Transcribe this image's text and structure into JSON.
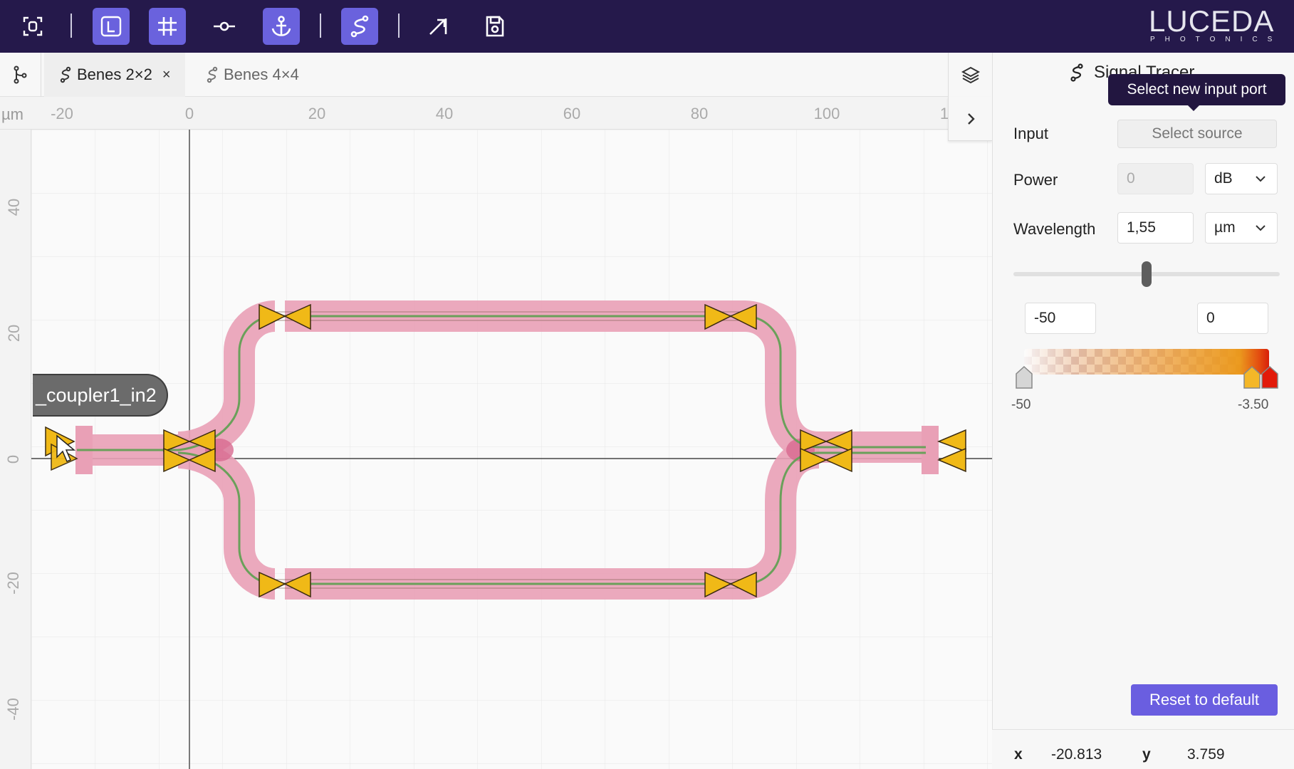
{
  "toolbar": {
    "buttons": [
      {
        "name": "fit-view",
        "icon": "fit-view-icon",
        "active": false
      },
      {
        "name": "layout-view",
        "icon": "layout-view-icon",
        "active": true
      },
      {
        "name": "grid-toggle",
        "icon": "grid-icon",
        "active": true
      },
      {
        "name": "port-tool",
        "icon": "port-icon",
        "active": false
      },
      {
        "name": "anchor-tool",
        "icon": "anchor-icon",
        "active": true
      },
      {
        "name": "route-tool",
        "icon": "route-icon",
        "active": true
      },
      {
        "name": "export",
        "icon": "export-icon",
        "active": false
      },
      {
        "name": "save",
        "icon": "save-icon",
        "active": false
      }
    ],
    "logo_main": "LUCEDA",
    "logo_sub": "PHOTONICS",
    "active_color": "#6a62dd",
    "bar_color": "#25194b"
  },
  "tabs": [
    {
      "label": "Benes 2×2",
      "active": true,
      "close": "×"
    },
    {
      "label": "Benes 4×4",
      "active": false
    }
  ],
  "ruler": {
    "unit": "µm",
    "x_ticks": [
      "-20",
      "0",
      "20",
      "40",
      "60",
      "80",
      "100",
      "1"
    ],
    "y_ticks": [
      "40",
      "20",
      "0",
      "-20",
      "-40"
    ]
  },
  "canvas": {
    "port_label": "_coupler1_in2",
    "waveguide_color": "#e9a0b6",
    "port_color": "#f0b917"
  },
  "panel": {
    "title": "Signal Tracer",
    "tooltip": "Select new input port",
    "input_label": "Input",
    "input_button": "Select source",
    "power_label": "Power",
    "power_value": "0",
    "power_unit": "dB",
    "wavelength_label": "Wavelength",
    "wavelength_value": "1,55",
    "wavelength_unit": "µm",
    "range_min": "-50",
    "range_max": "0",
    "gradient_min_label": "-50",
    "gradient_max_label": "-3.50",
    "reset_button": "Reset to default"
  },
  "status": {
    "x_label": "x",
    "x_value": "-20.813",
    "y_label": "y",
    "y_value": "3.759"
  }
}
